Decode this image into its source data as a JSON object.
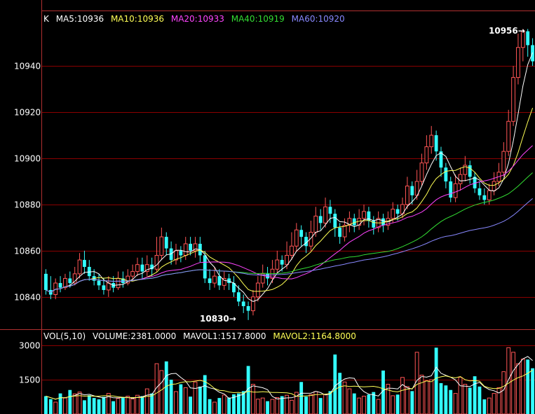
{
  "kline_legend": {
    "prefix": "K",
    "items": [
      {
        "label": "MA5:10936",
        "color": "#ffffff"
      },
      {
        "label": "MA10:10936",
        "color": "#ffff55"
      },
      {
        "label": "MA20:10933",
        "color": "#ff44ff"
      },
      {
        "label": "MA40:10919",
        "color": "#33dd33"
      },
      {
        "label": "MA60:10920",
        "color": "#8888ff"
      }
    ]
  },
  "vol_legend": {
    "items": [
      {
        "label": "VOL(5,10)",
        "color": "#ffffff"
      },
      {
        "label": "VOLUME:2381.0000",
        "color": "#ffffff"
      },
      {
        "label": "MAVOL1:1517.8000",
        "color": "#ffffff"
      },
      {
        "label": "MAVOL2:1164.8000",
        "color": "#ffff55"
      }
    ]
  },
  "colors": {
    "up": "#ff5555",
    "down": "#33ffff",
    "grid": "#8b0000",
    "frame": "#b03030",
    "tick_text": "#ffffff"
  },
  "chart_data": {
    "type": "candlestick",
    "price_axis": {
      "ticks": [
        10840,
        10860,
        10880,
        10900,
        10920,
        10940
      ],
      "ylim": [
        10826,
        10964
      ]
    },
    "volume_axis": {
      "ticks": [
        1500,
        3000
      ],
      "ylim": [
        0,
        3400
      ]
    },
    "max_label": {
      "value": "10956",
      "arrow": "→"
    },
    "min_label": {
      "value": "10830",
      "arrow": "→"
    },
    "candles": [
      [
        10850,
        10843,
        10852,
        10841
      ],
      [
        10843,
        10841,
        10849,
        10839
      ],
      [
        10841,
        10846,
        10848,
        10839
      ],
      [
        10846,
        10844,
        10849,
        10842
      ],
      [
        10844,
        10848,
        10850,
        10843
      ],
      [
        10848,
        10846,
        10851,
        10844
      ],
      [
        10846,
        10850,
        10853,
        10845
      ],
      [
        10850,
        10856,
        10859,
        10848
      ],
      [
        10856,
        10853,
        10860,
        10850
      ],
      [
        10853,
        10849,
        10856,
        10847
      ],
      [
        10849,
        10847,
        10852,
        10845
      ],
      [
        10847,
        10845,
        10850,
        10843
      ],
      [
        10845,
        10843,
        10848,
        10841
      ],
      [
        10843,
        10846,
        10849,
        10840
      ],
      [
        10846,
        10844,
        10849,
        10842
      ],
      [
        10844,
        10848,
        10851,
        10843
      ],
      [
        10848,
        10846,
        10851,
        10844
      ],
      [
        10846,
        10849,
        10852,
        10845
      ],
      [
        10849,
        10851,
        10854,
        10847
      ],
      [
        10851,
        10854,
        10857,
        10849
      ],
      [
        10854,
        10851,
        10857,
        10848
      ],
      [
        10851,
        10854,
        10858,
        10849
      ],
      [
        10854,
        10852,
        10857,
        10849
      ],
      [
        10852,
        10858,
        10866,
        10851
      ],
      [
        10858,
        10866,
        10870,
        10856
      ],
      [
        10866,
        10861,
        10868,
        10858
      ],
      [
        10861,
        10856,
        10864,
        10854
      ],
      [
        10856,
        10860,
        10863,
        10854
      ],
      [
        10860,
        10858,
        10862,
        10855
      ],
      [
        10858,
        10863,
        10866,
        10856
      ],
      [
        10863,
        10860,
        10866,
        10858
      ],
      [
        10860,
        10863,
        10866,
        10857
      ],
      [
        10863,
        10858,
        10866,
        10855
      ],
      [
        10858,
        10848,
        10860,
        10846
      ],
      [
        10848,
        10846,
        10852,
        10843
      ],
      [
        10846,
        10849,
        10853,
        10844
      ],
      [
        10849,
        10845,
        10852,
        10843
      ],
      [
        10845,
        10848,
        10851,
        10843
      ],
      [
        10848,
        10846,
        10850,
        10843
      ],
      [
        10846,
        10842,
        10849,
        10840
      ],
      [
        10842,
        10838,
        10845,
        10836
      ],
      [
        10838,
        10836,
        10841,
        10833
      ],
      [
        10836,
        10834,
        10838,
        10830
      ],
      [
        10834,
        10840,
        10843,
        10832
      ],
      [
        10840,
        10846,
        10849,
        10838
      ],
      [
        10846,
        10850,
        10854,
        10844
      ],
      [
        10850,
        10848,
        10853,
        10845
      ],
      [
        10848,
        10852,
        10856,
        10846
      ],
      [
        10852,
        10856,
        10860,
        10850
      ],
      [
        10856,
        10854,
        10858,
        10851
      ],
      [
        10854,
        10858,
        10864,
        10852
      ],
      [
        10858,
        10862,
        10868,
        10856
      ],
      [
        10862,
        10869,
        10872,
        10860
      ],
      [
        10869,
        10866,
        10871,
        10862
      ],
      [
        10866,
        10862,
        10868,
        10859
      ],
      [
        10862,
        10868,
        10873,
        10860
      ],
      [
        10868,
        10875,
        10879,
        10866
      ],
      [
        10875,
        10872,
        10878,
        10869
      ],
      [
        10872,
        10879,
        10883,
        10870
      ],
      [
        10879,
        10876,
        10882,
        10872
      ],
      [
        10876,
        10870,
        10878,
        10866
      ],
      [
        10870,
        10866,
        10872,
        10863
      ],
      [
        10866,
        10871,
        10874,
        10864
      ],
      [
        10871,
        10874,
        10877,
        10868
      ],
      [
        10874,
        10871,
        10876,
        10868
      ],
      [
        10871,
        10874,
        10878,
        10869
      ],
      [
        10874,
        10877,
        10880,
        10871
      ],
      [
        10877,
        10873,
        10879,
        10870
      ],
      [
        10873,
        10870,
        10875,
        10867
      ],
      [
        10870,
        10874,
        10877,
        10868
      ],
      [
        10874,
        10871,
        10876,
        10868
      ],
      [
        10871,
        10874,
        10877,
        10869
      ],
      [
        10874,
        10878,
        10881,
        10872
      ],
      [
        10878,
        10876,
        10880,
        10873
      ],
      [
        10876,
        10880,
        10883,
        10874
      ],
      [
        10880,
        10888,
        10892,
        10878
      ],
      [
        10888,
        10884,
        10890,
        10880
      ],
      [
        10884,
        10890,
        10895,
        10882
      ],
      [
        10890,
        10898,
        10902,
        10888
      ],
      [
        10898,
        10905,
        10910,
        10895
      ],
      [
        10905,
        10910,
        10914,
        10902
      ],
      [
        10910,
        10903,
        10912,
        10899
      ],
      [
        10903,
        10896,
        10905,
        10892
      ],
      [
        10896,
        10890,
        10898,
        10887
      ],
      [
        10890,
        10883,
        10892,
        10881
      ],
      [
        10883,
        10889,
        10893,
        10881
      ],
      [
        10889,
        10893,
        10896,
        10886
      ],
      [
        10893,
        10897,
        10901,
        10890
      ],
      [
        10897,
        10892,
        10899,
        10889
      ],
      [
        10892,
        10887,
        10894,
        10885
      ],
      [
        10887,
        10884,
        10890,
        10882
      ],
      [
        10884,
        10882,
        10887,
        10880
      ],
      [
        10882,
        10886,
        10889,
        10880
      ],
      [
        10886,
        10890,
        10894,
        10884
      ],
      [
        10890,
        10894,
        10898,
        10888
      ],
      [
        10894,
        10903,
        10907,
        10892
      ],
      [
        10903,
        10916,
        10921,
        10901
      ],
      [
        10916,
        10935,
        10940,
        10914
      ],
      [
        10935,
        10948,
        10954,
        10932
      ],
      [
        10948,
        10955,
        10956,
        10942
      ],
      [
        10955,
        10949,
        10956,
        10944
      ],
      [
        10949,
        10942,
        10952,
        10940
      ]
    ],
    "volumes": [
      780,
      650,
      520,
      900,
      700,
      1050,
      880,
      960,
      600,
      820,
      700,
      640,
      750,
      900,
      560,
      680,
      720,
      780,
      660,
      820,
      780,
      1100,
      900,
      2200,
      1900,
      2300,
      1500,
      980,
      1300,
      1150,
      760,
      1400,
      1200,
      1700,
      650,
      520,
      700,
      830,
      720,
      860,
      900,
      1000,
      2100,
      1300,
      650,
      700,
      560,
      640,
      720,
      780,
      820,
      600,
      950,
      1400,
      760,
      850,
      980,
      700,
      860,
      1000,
      2600,
      1800,
      1400,
      1100,
      900,
      700,
      780,
      850,
      960,
      640,
      1900,
      1300,
      800,
      850,
      1600,
      1200,
      1000,
      2700,
      1700,
      1450,
      1500,
      2900,
      1350,
      1250,
      1050,
      900,
      1600,
      1300,
      1150,
      1650,
      1200,
      640,
      700,
      900,
      1150,
      1850,
      2900,
      2700,
      2200,
      2400,
      2381,
      2000
    ]
  }
}
